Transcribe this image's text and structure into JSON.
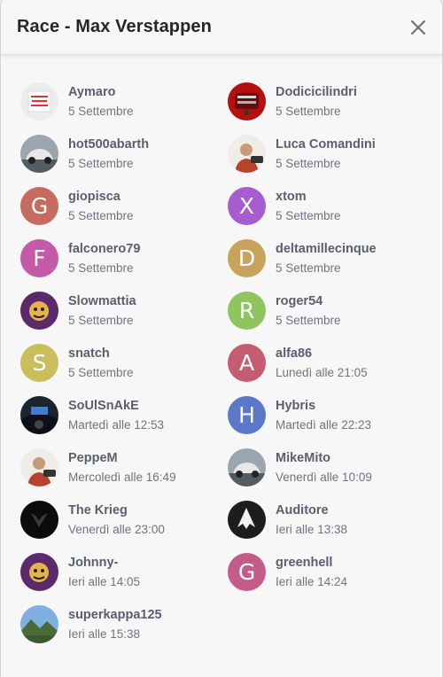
{
  "modal": {
    "title": "Race - Max Verstappen",
    "close_icon": "close-icon"
  },
  "colors": {
    "giopisca": "#c86b5f",
    "xtom": "#a75ccf",
    "falconero79": "#c45aa8",
    "deltamillecinque": "#c8a35c",
    "roger54": "#8fc45e",
    "snatch": "#c9bd5c",
    "alfa86": "#c45c72",
    "Hybris": "#5c78c9",
    "greenhell": "#c45c8a"
  },
  "users": [
    {
      "name": "Aymaro",
      "date": "5 Settembre",
      "avatar_type": "image",
      "avatar_icon": "profile-photo-placeholder"
    },
    {
      "name": "Dodicicilindri",
      "date": "5 Settembre",
      "avatar_type": "image",
      "avatar_icon": "engine-photo"
    },
    {
      "name": "hot500abarth",
      "date": "5 Settembre",
      "avatar_type": "image",
      "avatar_icon": "car-photo"
    },
    {
      "name": "Luca Comandini",
      "date": "5 Settembre",
      "avatar_type": "image",
      "avatar_icon": "person-photo"
    },
    {
      "name": "giopisca",
      "date": "5 Settembre",
      "avatar_type": "letter",
      "letter": "G",
      "color": "#c86b5f"
    },
    {
      "name": "xtom",
      "date": "5 Settembre",
      "avatar_type": "letter",
      "letter": "X",
      "color": "#a75ccf"
    },
    {
      "name": "falconero79",
      "date": "5 Settembre",
      "avatar_type": "letter",
      "letter": "F",
      "color": "#c45aa8"
    },
    {
      "name": "deltamillecinque",
      "date": "5 Settembre",
      "avatar_type": "letter",
      "letter": "D",
      "color": "#c8a35c"
    },
    {
      "name": "Slowmattia",
      "date": "5 Settembre",
      "avatar_type": "image",
      "avatar_icon": "cartoon-photo"
    },
    {
      "name": "roger54",
      "date": "5 Settembre",
      "avatar_type": "letter",
      "letter": "R",
      "color": "#8fc45e"
    },
    {
      "name": "snatch",
      "date": "5 Settembre",
      "avatar_type": "letter",
      "letter": "S",
      "color": "#c9bd5c"
    },
    {
      "name": "alfa86",
      "date": "Lunedì alle 21:05",
      "avatar_type": "letter",
      "letter": "A",
      "color": "#c45c72"
    },
    {
      "name": "SoUlSnAkE",
      "date": "Martedì alle 12:53",
      "avatar_type": "image",
      "avatar_icon": "cockpit-photo"
    },
    {
      "name": "Hybris",
      "date": "Martedì alle 22:23",
      "avatar_type": "letter",
      "letter": "H",
      "color": "#5c78c9"
    },
    {
      "name": "PeppeM",
      "date": "Mercoledì alle 16:49",
      "avatar_type": "image",
      "avatar_icon": "person-photo"
    },
    {
      "name": "MikeMito",
      "date": "Venerdì alle 10:09",
      "avatar_type": "image",
      "avatar_icon": "car-photo"
    },
    {
      "name": "The Krieg",
      "date": "Venerdì alle 23:00",
      "avatar_type": "image",
      "avatar_icon": "dark-photo"
    },
    {
      "name": "Auditore",
      "date": "Ieri alle 13:38",
      "avatar_type": "image",
      "avatar_icon": "assassin-logo"
    },
    {
      "name": "Johnny-",
      "date": "Ieri alle 14:05",
      "avatar_type": "image",
      "avatar_icon": "cartoon-photo"
    },
    {
      "name": "greenhell",
      "date": "Ieri alle 14:24",
      "avatar_type": "letter",
      "letter": "G",
      "color": "#c45c8a"
    },
    {
      "name": "superkappa125",
      "date": "Ieri alle 15:38",
      "avatar_type": "image",
      "avatar_icon": "landscape-photo"
    }
  ]
}
